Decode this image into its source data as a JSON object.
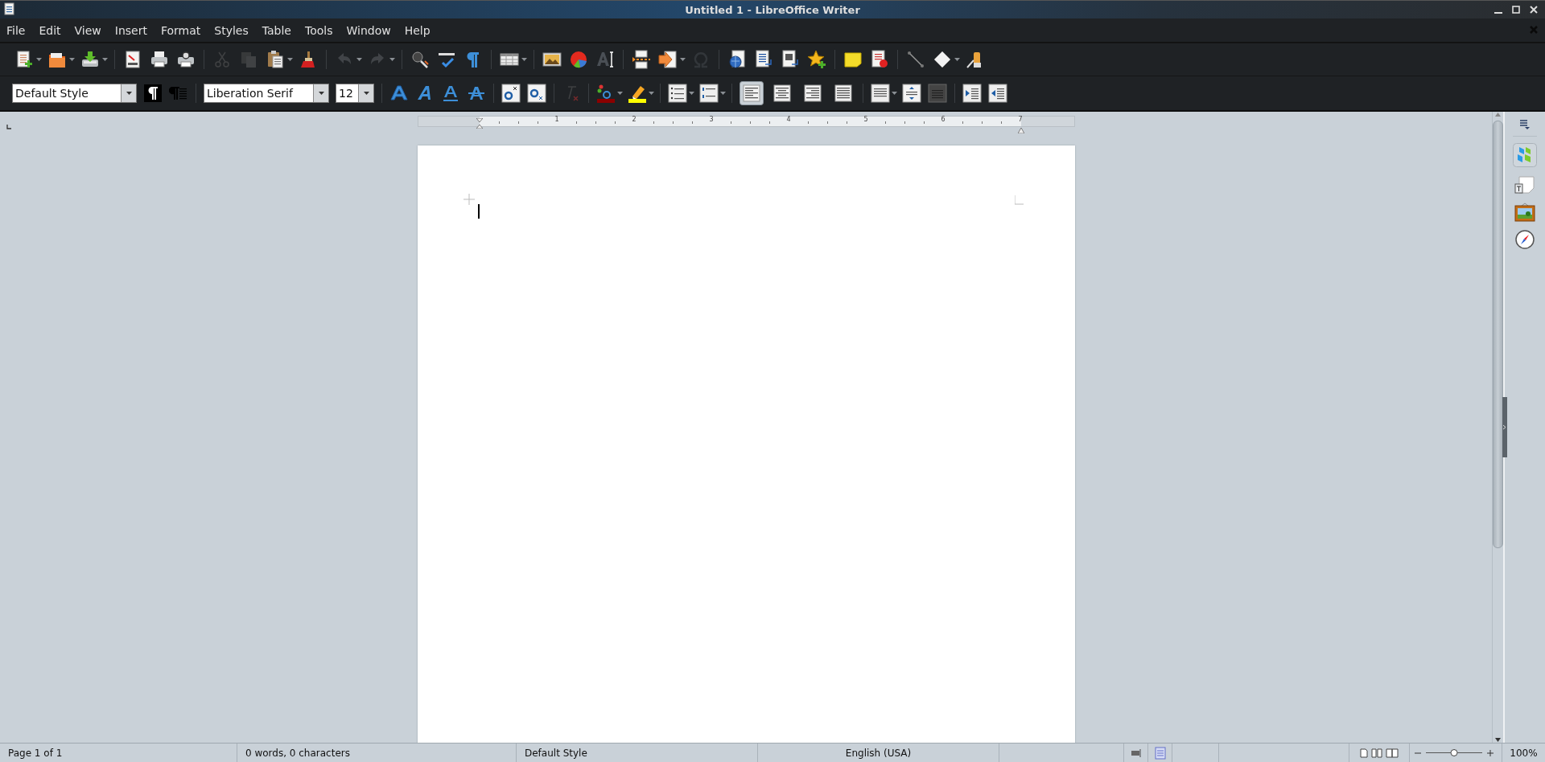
{
  "window": {
    "title": "Untitled 1 - LibreOffice Writer"
  },
  "menu": [
    "File",
    "Edit",
    "View",
    "Insert",
    "Format",
    "Styles",
    "Table",
    "Tools",
    "Window",
    "Help"
  ],
  "formatting": {
    "paragraph_style": "Default Style",
    "font_name": "Liberation Serif",
    "font_size": "12",
    "alignment": [
      {
        "selected": true
      },
      {
        "selected": false
      },
      {
        "selected": false
      },
      {
        "selected": false
      }
    ]
  },
  "ruler": {
    "numbers": [
      "1",
      "2",
      "3",
      "4",
      "5",
      "6",
      "7"
    ]
  },
  "status_bar": {
    "page": "Page 1 of 1",
    "word_count": "0 words, 0 characters",
    "page_style": "Default Style",
    "language": "English (USA)",
    "zoom_slider": {
      "level": 0.5
    },
    "zoom": "100%"
  }
}
